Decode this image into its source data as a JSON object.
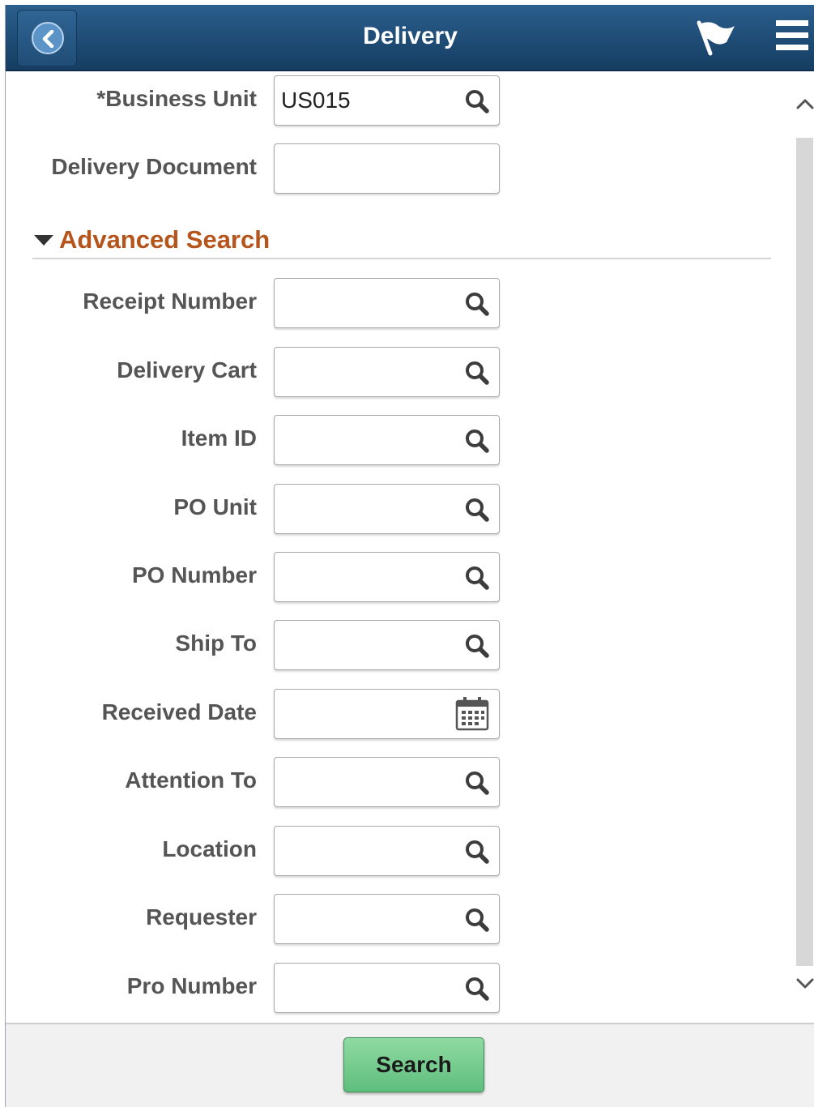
{
  "header": {
    "title": "Delivery",
    "back_icon": "chevron-left-icon",
    "flag_icon": "flag-icon",
    "menu_icon": "hamburger-menu-icon",
    "bar_color": "#1d4a73"
  },
  "fields_top": [
    {
      "label": "*Business Unit",
      "value": "US015",
      "icon": "search-icon"
    },
    {
      "label": "Delivery Document",
      "value": "",
      "icon": ""
    }
  ],
  "advanced_search": {
    "label": "Advanced Search",
    "expanded": true,
    "color": "#b5541b"
  },
  "fields_advanced": [
    {
      "label": "Receipt Number",
      "value": "",
      "icon": "search-icon"
    },
    {
      "label": "Delivery Cart",
      "value": "",
      "icon": "search-icon"
    },
    {
      "label": "Item ID",
      "value": "",
      "icon": "search-icon"
    },
    {
      "label": "PO Unit",
      "value": "",
      "icon": "search-icon"
    },
    {
      "label": "PO Number",
      "value": "",
      "icon": "search-icon"
    },
    {
      "label": "Ship To",
      "value": "",
      "icon": "search-icon"
    },
    {
      "label": "Received Date",
      "value": "",
      "icon": "calendar-icon"
    },
    {
      "label": "Attention To",
      "value": "",
      "icon": "search-icon"
    },
    {
      "label": "Location",
      "value": "",
      "icon": "search-icon"
    },
    {
      "label": "Requester",
      "value": "",
      "icon": "search-icon"
    },
    {
      "label": "Pro Number",
      "value": "",
      "icon": "search-icon"
    }
  ],
  "footer": {
    "search_label": "Search",
    "button_color": "#6cc88a"
  }
}
